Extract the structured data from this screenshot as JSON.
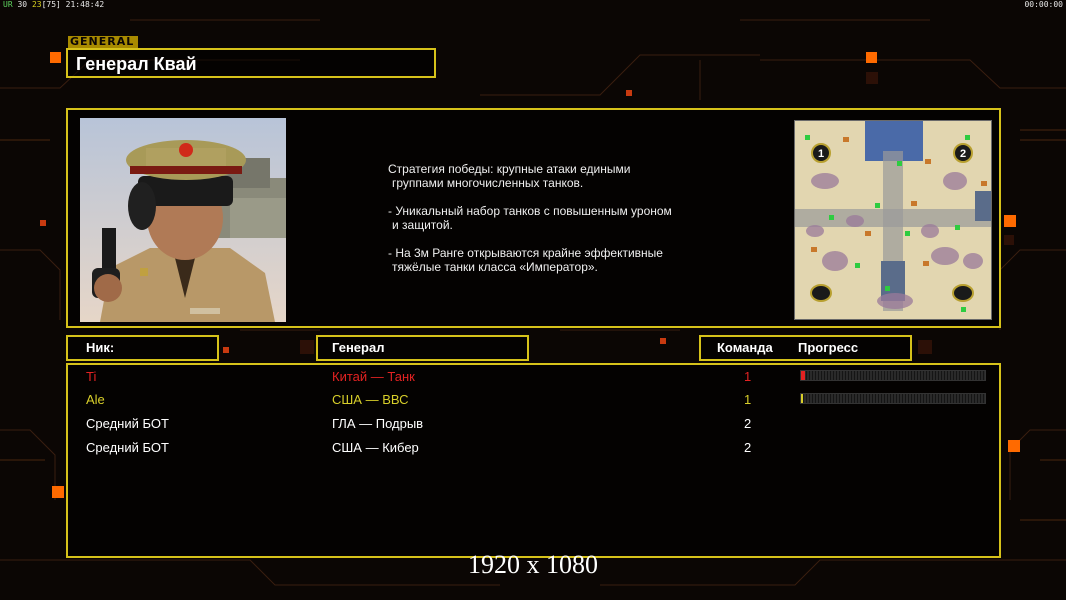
{
  "hud": {
    "label_ur": "UR",
    "fps": "30",
    "count": "23",
    "bracket_value": "[75]",
    "clock": "21:48:42",
    "timer": "00:00:00"
  },
  "section_tag": "GENERAL",
  "general_title": "Генерал Квай",
  "description": {
    "p1_line1": "Стратегия победы: крупные атаки едиными",
    "p1_line2": "группами многочисленных танков.",
    "p2_line1": "- Уникальный набор танков с повышенным уроном",
    "p2_line2": "и защитой.",
    "p3_line1": "- На 3м Ранге открываются крайне эффективные",
    "p3_line2": "тяжёлые танки класса «Император»."
  },
  "map": {
    "start_1": "1",
    "start_2": "2"
  },
  "headers": {
    "nick": "Ник:",
    "general": "Генерал",
    "team": "Команда",
    "progress": "Прогресс"
  },
  "players": [
    {
      "nick": "Ti",
      "general": "Китай — Танк",
      "team": "1",
      "color": "#e32222",
      "progress": 0.02,
      "show_progress": true
    },
    {
      "nick": "Ale",
      "general": "США — ВВС",
      "team": "1",
      "color": "#d8cf2a",
      "progress": 0.01,
      "show_progress": true
    },
    {
      "nick": "Средний БОТ",
      "general": "ГЛА — Подрыв",
      "team": "2",
      "color": "#ffffff",
      "progress": 0,
      "show_progress": false
    },
    {
      "nick": "Средний БОТ",
      "general": "США — Кибер",
      "team": "2",
      "color": "#ffffff",
      "progress": 0,
      "show_progress": false
    }
  ],
  "resolution_label": "1920 x 1080",
  "colors": {
    "accent": "#d6c21a",
    "background": "#0b0604",
    "glow_orange": "#ff6a00"
  }
}
